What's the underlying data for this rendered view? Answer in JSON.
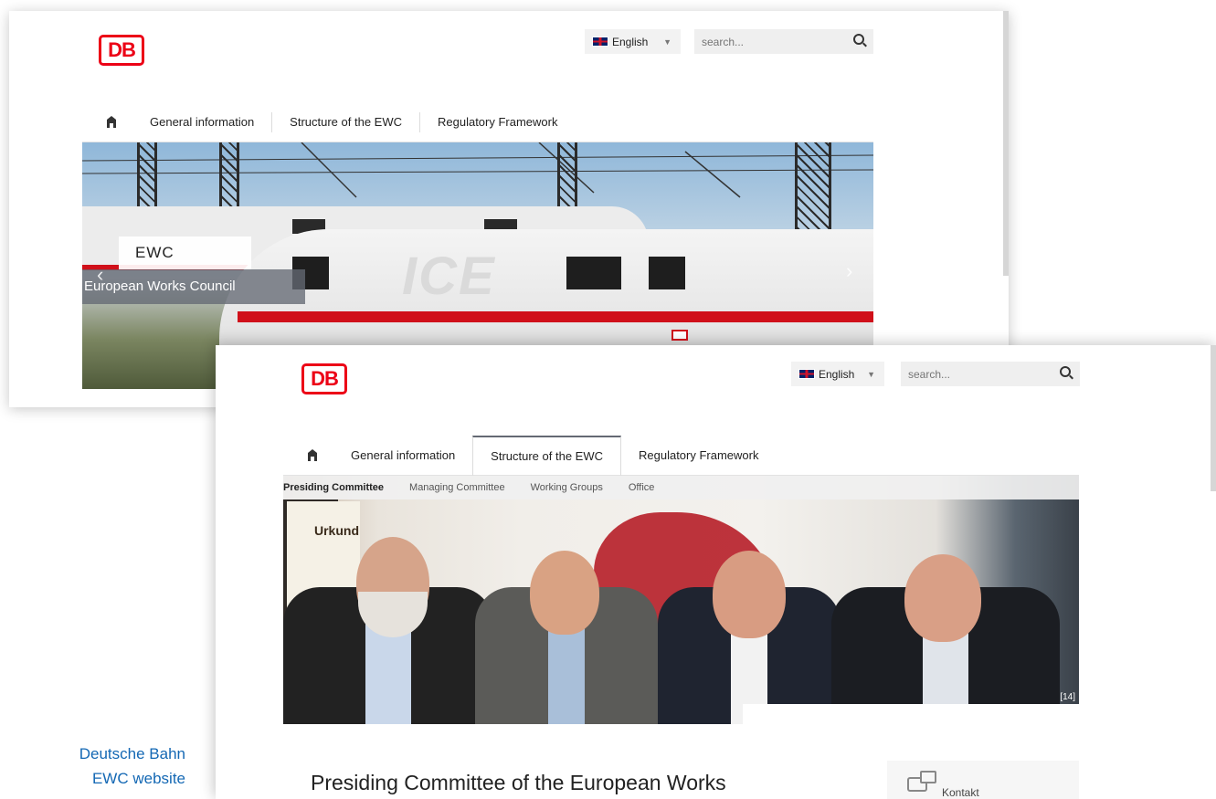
{
  "screenshot_back": {
    "logo": "DB",
    "language": {
      "label": "English",
      "icon": "uk-flag-icon"
    },
    "search": {
      "placeholder": "search..."
    },
    "nav": {
      "home_icon": "home-icon",
      "items": [
        "General information",
        "Structure of the EWC",
        "Regulatory Framework"
      ]
    },
    "hero": {
      "title": "EWC",
      "subtitle": "European Works Council",
      "prev_arrow": "‹",
      "next_arrow": "›",
      "train_mark": "ICE"
    }
  },
  "screenshot_front": {
    "logo": "DB",
    "language": {
      "label": "English",
      "icon": "uk-flag-icon"
    },
    "search": {
      "placeholder": "search..."
    },
    "nav": {
      "home_icon": "home-icon",
      "items": [
        "General information",
        "Structure of the EWC",
        "Regulatory Framework"
      ],
      "active_index": 1
    },
    "subnav": {
      "items": [
        "Presiding Committee",
        "Managing Committee",
        "Working Groups",
        "Office"
      ],
      "active_index": 0
    },
    "hero": {
      "board_text": "Urkund",
      "image_index": "[14]"
    },
    "headline": "Presiding Committee of the European Works",
    "contact": {
      "label": "Kontakt",
      "icon": "chat-icon"
    }
  },
  "caption": {
    "line1": "Deutsche Bahn",
    "line2": "EWC website"
  },
  "colors": {
    "db_red": "#ec0016",
    "caption_blue": "#1468b4",
    "nav_active": "#646973"
  }
}
